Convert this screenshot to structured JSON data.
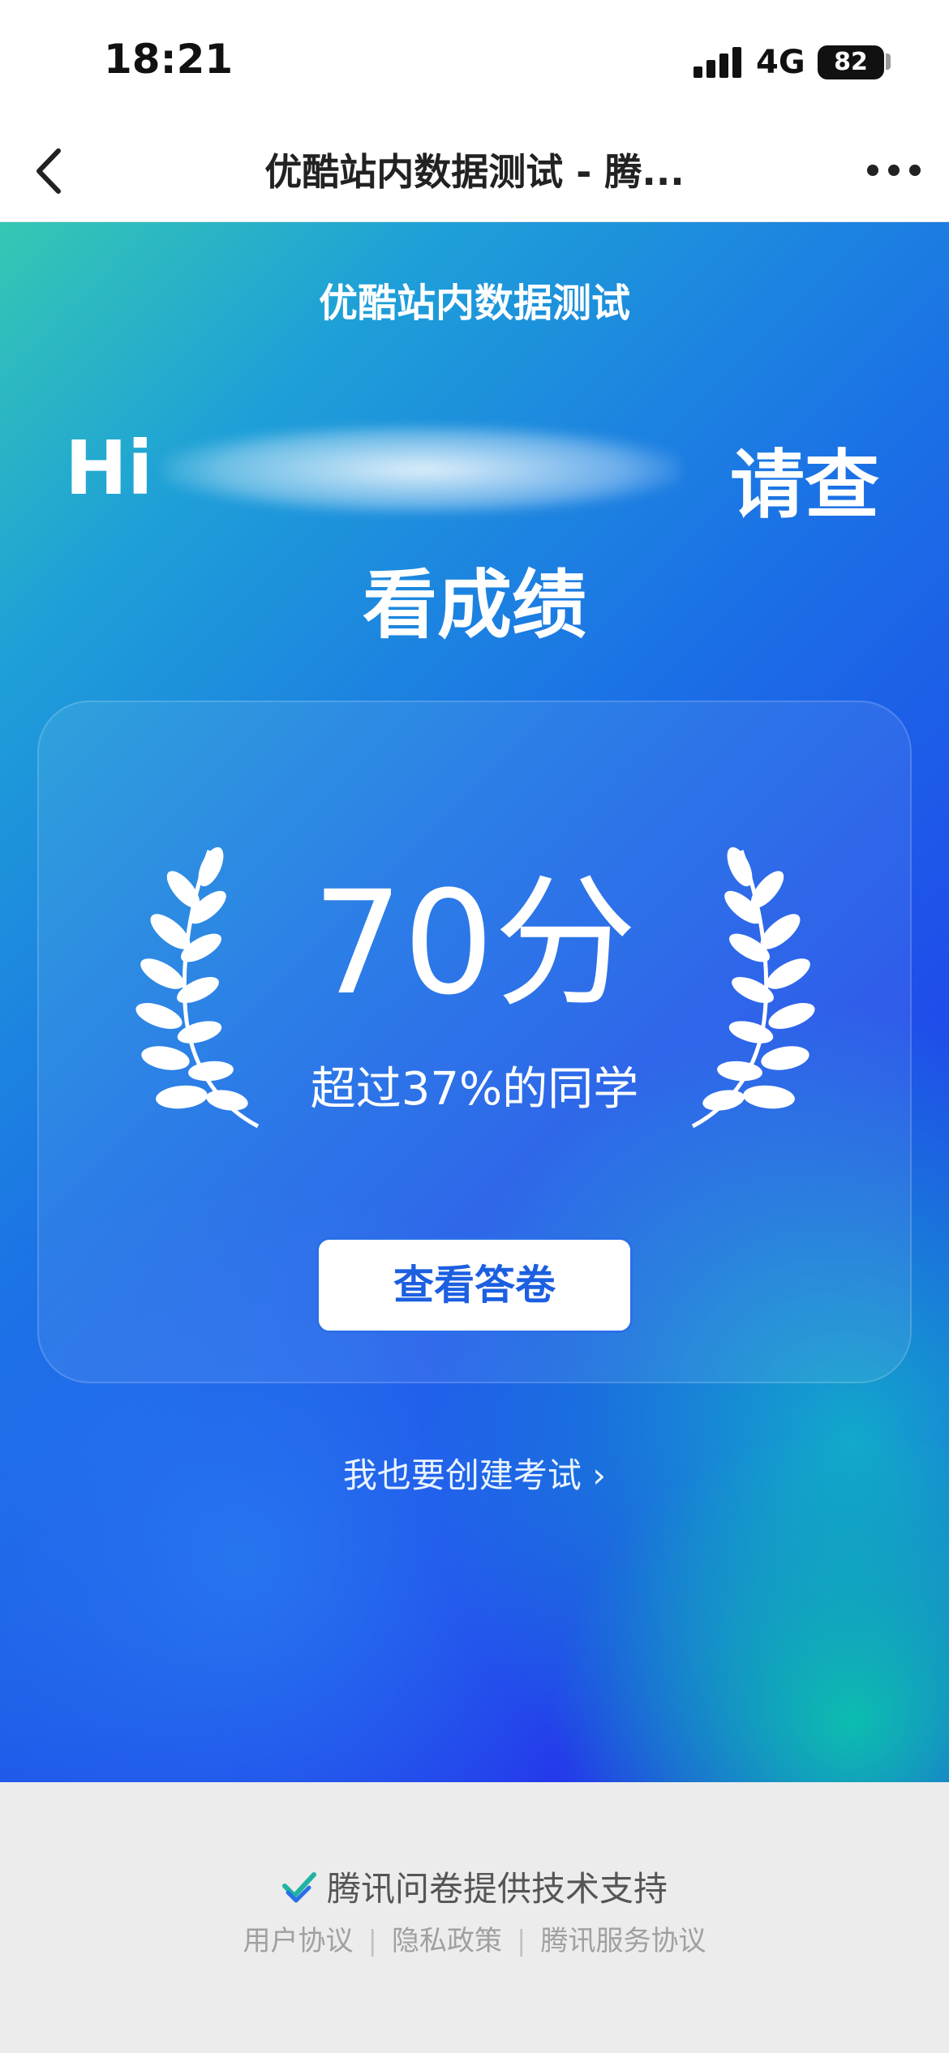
{
  "status_bar": {
    "time": "18:21",
    "network": "4G",
    "battery": "82"
  },
  "nav": {
    "title": "优酷站内数据测试 - 腾...",
    "back_icon": "chevron-left-icon",
    "more_icon": "ellipsis-icon"
  },
  "hero": {
    "survey_title": "优酷站内数据测试",
    "greeting_prefix": "Hi",
    "greeting_suffix": "请查",
    "greeting_line2": "看成绩",
    "score": "70分",
    "score_sub": "超过37%的同学",
    "view_answers_label": "查看答卷",
    "create_exam_label": "我也要创建考试 ›"
  },
  "footer": {
    "powered_by": "腾讯问卷提供技术支持",
    "links": [
      "用户协议",
      "隐私政策",
      "腾讯服务协议"
    ]
  },
  "colors": {
    "accent": "#1c5fe0",
    "gradient_start": "#35c8b3",
    "gradient_end": "#2a25ec"
  }
}
